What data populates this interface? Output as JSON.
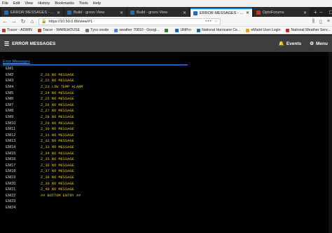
{
  "menubar": [
    "File",
    "Edit",
    "View",
    "History",
    "Bookmarks",
    "Tools",
    "Help"
  ],
  "tabs": [
    {
      "label": "ERROR MESSAGES - groov",
      "icon_color": "#2b6cb0",
      "active": false
    },
    {
      "label": "Build - groov View",
      "icon_color": "#2b6cb0",
      "active": false
    },
    {
      "label": "Build - groov View",
      "icon_color": "#2b6cb0",
      "active": false
    },
    {
      "label": "ERROR MESSAGES - groov",
      "icon_color": "#2b6cb0",
      "active": true
    },
    {
      "label": "OptoForums",
      "icon_color": "#c0392b",
      "active": false
    }
  ],
  "nav": {
    "url": "https://10.50.0.89/view/#1",
    "dots": "•••"
  },
  "bookmarks": [
    {
      "label": "Tracer - ADMIN",
      "icon_color": "#c0392b"
    },
    {
      "label": "Tracer - WAREHOUSE",
      "icon_color": "#c0392b"
    },
    {
      "label": "Tyco onsite",
      "icon_color": "#777777"
    },
    {
      "label": "weather 70810 - Googl...",
      "icon_color": "#4285f4"
    },
    {
      "label": "",
      "icon_color": "#2e7d32"
    },
    {
      "label": "UltiPro",
      "icon_color": "#1565c0"
    },
    {
      "label": "National Hurricane Ce...",
      "icon_color": "#1565c0"
    },
    {
      "label": "eMaint User Login",
      "icon_color": "#f39c12"
    },
    {
      "label": "National Weather Serv...",
      "icon_color": "#c62828"
    }
  ],
  "app": {
    "title": "ERROR MESSAGES",
    "events_label": "Events",
    "menu_label": "Menu"
  },
  "section": {
    "title": "Error Messages"
  },
  "messages": [
    {
      "label": "EM1",
      "value": ""
    },
    {
      "label": "EM2",
      "value": "Z_20 NO MESSAGE"
    },
    {
      "label": "EM3",
      "value": "Z_22 NO MESSAGE"
    },
    {
      "label": "EM4",
      "value": "Z_23 LOW TEMP ALARM"
    },
    {
      "label": "EM5",
      "value": "Z_24 NO MESSAGE"
    },
    {
      "label": "EM6",
      "value": "Z_25 NO MESSAGE"
    },
    {
      "label": "EM7",
      "value": "Z_26 NO MESSAGE"
    },
    {
      "label": "EM8",
      "value": "Z_27 NO MESSAGE"
    },
    {
      "label": "EM9",
      "value": "Z_28 NO MESSAGE"
    },
    {
      "label": "EM10",
      "value": "Z_29 NO MESSAGE"
    },
    {
      "label": "EM11",
      "value": "Z_30 NO MESSAGE"
    },
    {
      "label": "EM12",
      "value": "Z_31 NO MESSAGE"
    },
    {
      "label": "EM13",
      "value": "Z_32 NO MESSAGE"
    },
    {
      "label": "EM14",
      "value": "Z_33 NO MESSAGE"
    },
    {
      "label": "EM15",
      "value": "Z_34 NO MESSAGE"
    },
    {
      "label": "EM16",
      "value": "Z_35 NO MESSAGE"
    },
    {
      "label": "EM17",
      "value": "Z_36 NO MESSAGE"
    },
    {
      "label": "EM18",
      "value": "Z_37 NO MESSAGE"
    },
    {
      "label": "EM19",
      "value": "Z_38 NO MESSAGE"
    },
    {
      "label": "EM20",
      "value": "Z_39 NO MESSAGE"
    },
    {
      "label": "EM21",
      "value": "Z_40 NO MESSAGE"
    },
    {
      "label": "EM22",
      "value": "## BOTTOM ENTRY ##"
    },
    {
      "label": "EM23",
      "value": ""
    },
    {
      "label": "EM24",
      "value": ""
    }
  ],
  "colors": {
    "label_text": "#d8d8d8",
    "value_text": "#e3c51b",
    "section_title": "#4fa3ff",
    "header_bg": "#3e3e3e"
  }
}
